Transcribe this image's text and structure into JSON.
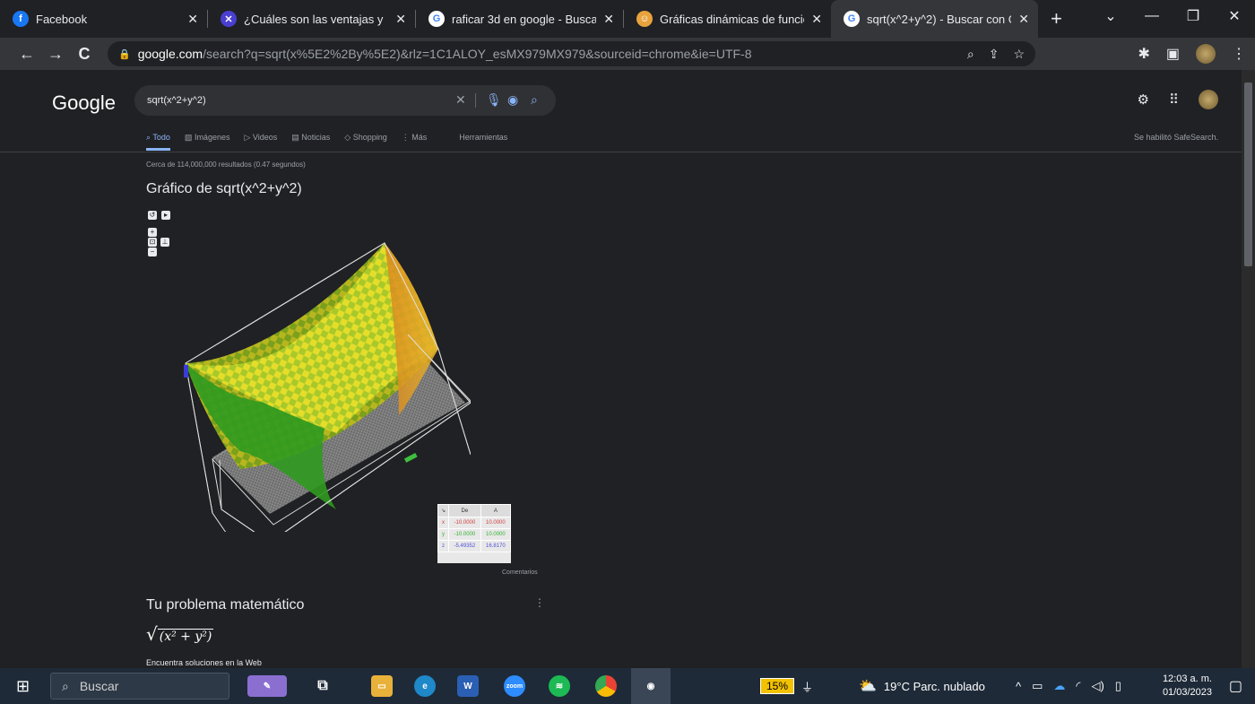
{
  "tabs": [
    {
      "title": "Facebook",
      "icon": "facebook-icon",
      "color": "#1877f2",
      "glyph": "f"
    },
    {
      "title": "¿Cuáles son las ventajas y",
      "icon": "site-icon",
      "color": "#4a3fd1",
      "glyph": "✕"
    },
    {
      "title": "raficar 3d en google - Buscar",
      "icon": "google-icon",
      "color": "#ffffff",
      "glyph": "G"
    },
    {
      "title": "Gráficas dinámicas de funcio",
      "icon": "site-icon",
      "color": "#e8a33d",
      "glyph": "☺"
    },
    {
      "title": "sqrt(x^2+y^2) - Buscar con G",
      "icon": "google-icon",
      "color": "#ffffff",
      "glyph": "G",
      "active": true
    }
  ],
  "url": {
    "domain": "google.com",
    "path": "/search?q=sqrt(x%5E2%2By%5E2)&rlz=1C1ALOY_esMX979MX979&sourceid=chrome&ie=UTF-8"
  },
  "google": {
    "logo": "Google",
    "query": "sqrt(x^2+y^2)",
    "nav": [
      "Todo",
      "Imágenes",
      "Videos",
      "Noticias",
      "Shopping",
      "⋮ Más",
      "Herramientas"
    ],
    "safesearch": "Se habilitó SafeSearch.",
    "count": "Cerca de 114,000,000 resultados (0.47 segundos)",
    "graph_title": "Gráfico de sqrt(x^2+y^2)",
    "range": {
      "headers": [
        "De",
        "A"
      ],
      "rows": [
        {
          "axis": "x",
          "from": "-10.0000",
          "to": "10.0000",
          "color": "#d23c3c"
        },
        {
          "axis": "y",
          "from": "-10.0000",
          "to": "10.0000",
          "color": "#33b233"
        },
        {
          "axis": "z",
          "from": "-5.49352",
          "to": "16.8170",
          "color": "#5050d8"
        }
      ]
    },
    "comments": "Comentarios",
    "problem_title": "Tu problema matemático",
    "find_solutions": "Encuentra soluciones en la Web"
  },
  "taskbar": {
    "search": "Buscar",
    "battery": "15%",
    "weather": "19°C  Parc. nublado",
    "time": "12:03 a. m.",
    "date": "01/03/2023"
  }
}
